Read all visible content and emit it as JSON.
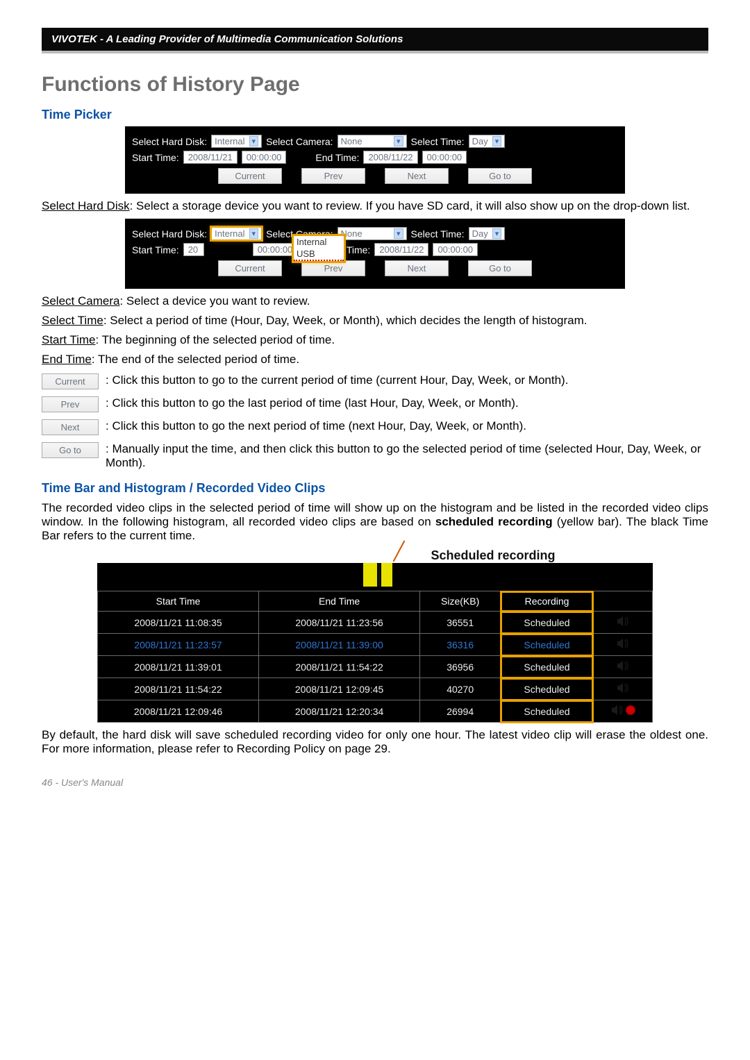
{
  "header": {
    "brand": "VIVOTEK - A Leading Provider of Multimedia Communication Solutions"
  },
  "title": "Functions of History Page",
  "timepicker": {
    "heading": "Time Picker",
    "labels": {
      "hdisk": "Select Hard Disk:",
      "camera": "Select Camera:",
      "time": "Select Time:",
      "start": "Start Time:",
      "end": "End Time:"
    },
    "values": {
      "hdisk": "Internal",
      "camera": "None",
      "time": "Day",
      "start_date": "2008/11/21",
      "start_time": "00:00:00",
      "end_date": "2008/11/22",
      "end_time": "00:00:00"
    },
    "dd_options": {
      "o1": "Internal",
      "o2": "USB",
      "prefix": "20"
    },
    "buttons": {
      "current": "Current",
      "prev": "Prev",
      "next": "Next",
      "goto": "Go to"
    }
  },
  "descriptions": {
    "hdisk_label": "Select Hard Disk",
    "hdisk_text": ": Select a storage device you want to review. If you have SD card, it will also show up on the drop-down list.",
    "camera_label": "Select Camera",
    "camera_text": ": Select a device you want to review.",
    "time_label": "Select Time",
    "time_text": ": Select a period of time (Hour, Day, Week, or Month), which decides the length of histogram.",
    "start_label": "Start Time",
    "start_text": ": The beginning of the selected period of time.",
    "end_label": "End Time",
    "end_text": ": The end of the selected period of time.",
    "btn_current": ": Click this button to go to the current period of time (current Hour, Day, Week, or Month).",
    "btn_prev": ": Click this button to go the last period of time (last Hour, Day, Week, or Month).",
    "btn_next": ": Click this button to go the next period of time (next Hour, Day, Week, or Month).",
    "btn_goto": ": Manually input the time, and then click this button to go the selected period of time (selected Hour, Day, Week, or Month)."
  },
  "clips_section": {
    "heading": "Time Bar and Histogram / Recorded Video Clips",
    "intro_a": "The recorded video clips in the selected period of time will show up on the histogram and be listed in the recorded video clips window. In the following histogram, all recorded video clips are based on ",
    "intro_b": "scheduled recording",
    "intro_c": " (yellow bar). The black Time Bar refers to the current time.",
    "callout": "Scheduled recording",
    "cols": {
      "start": "Start Time",
      "end": "End Time",
      "size": "Size(KB)",
      "rec": "Recording"
    },
    "rows": [
      {
        "s": "2008/11/21 11:08:35",
        "e": "2008/11/21 11:23:56",
        "k": "36551",
        "r": "Scheduled",
        "rec": false
      },
      {
        "s": "2008/11/21 11:23:57",
        "e": "2008/11/21 11:39:00",
        "k": "36316",
        "r": "Scheduled",
        "rec": false
      },
      {
        "s": "2008/11/21 11:39:01",
        "e": "2008/11/21 11:54:22",
        "k": "36956",
        "r": "Scheduled",
        "rec": false
      },
      {
        "s": "2008/11/21 11:54:22",
        "e": "2008/11/21 12:09:45",
        "k": "40270",
        "r": "Scheduled",
        "rec": false
      },
      {
        "s": "2008/11/21 12:09:46",
        "e": "2008/11/21 12:20:34",
        "k": "26994",
        "r": "Scheduled",
        "rec": true
      }
    ],
    "outro": "By default, the hard disk will save scheduled recording video for only one hour. The latest video clip will erase the oldest one. For more information, please refer to Recording Policy on page 29."
  },
  "footer": {
    "page": "46 - User's Manual"
  }
}
